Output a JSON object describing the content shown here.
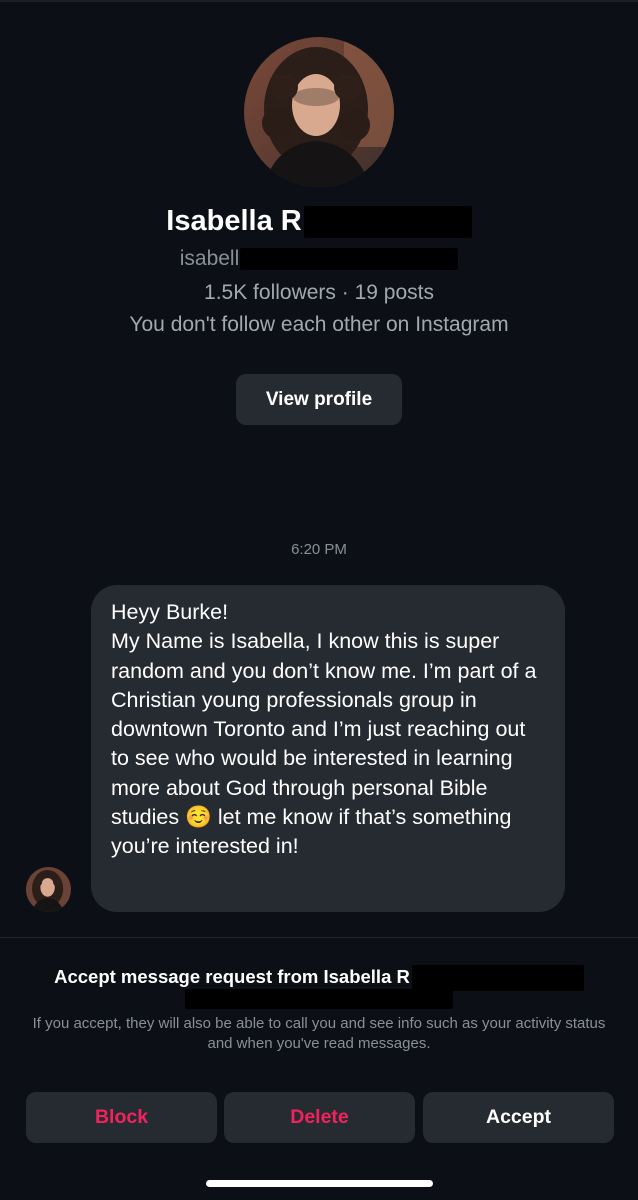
{
  "profile": {
    "name_visible": "Isabella R",
    "handle_visible": "isabell",
    "stats": "1.5K followers · 19 posts",
    "follow_status": "You don't follow each other on Instagram",
    "view_profile_label": "View profile"
  },
  "thread": {
    "timestamp": "6:20 PM",
    "message": "Heyy Burke!\nMy Name is Isabella, I know this is super random and you don’t know me. I’m part of a Christian young professionals group in downtown Toronto and I’m just reaching out to see who would be interested in learning more about God through personal Bible studies ☺️ let me know if that’s something you’re interested in!"
  },
  "request": {
    "title_visible": "Accept message request from Isabella R",
    "description": "If you accept, they will also be able to call you and see info such as your activity status and when you've read messages.",
    "block_label": "Block",
    "delete_label": "Delete",
    "accept_label": "Accept"
  },
  "colors": {
    "background": "#0c1016",
    "surface": "#262a31",
    "destructive": "#f0235c",
    "muted_text": "#a3a8b0"
  }
}
